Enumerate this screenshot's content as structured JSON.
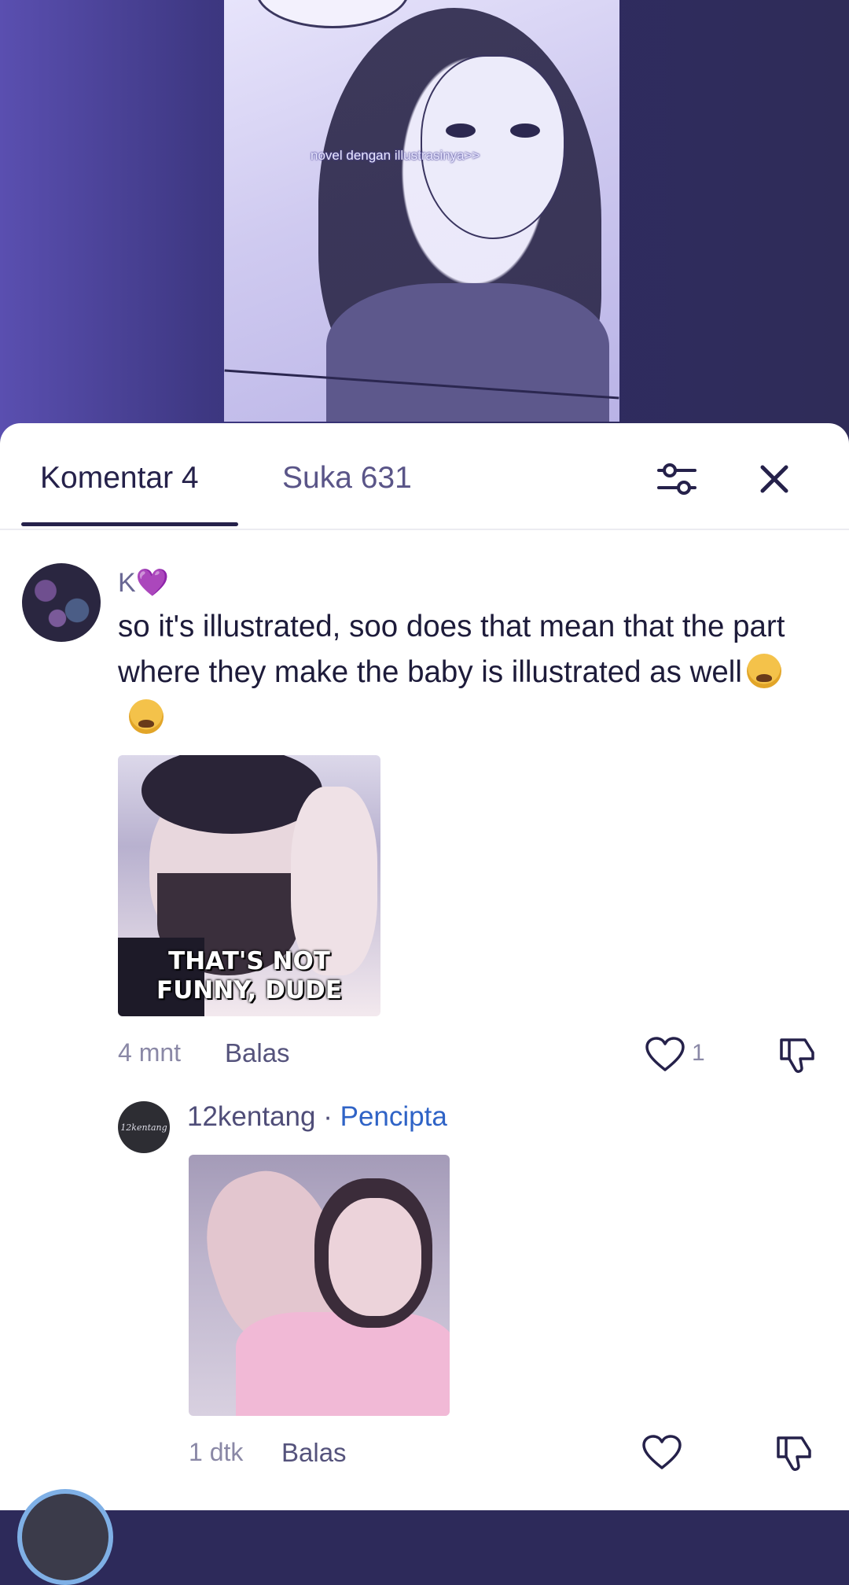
{
  "video": {
    "caption": "novel dengan illustrasinya>>"
  },
  "tabs": [
    {
      "label": "Komentar 4",
      "active": true
    },
    {
      "label": "Suka 631",
      "active": false
    }
  ],
  "toolbar": {
    "filter_icon": "sliders-icon",
    "close_icon": "close-icon"
  },
  "comments": [
    {
      "username": "K💜",
      "text": "so it's illustrated, soo does that mean that the part where they make the baby is illustrated as well",
      "emojis": [
        "loudly-crying-face",
        "loudly-crying-face"
      ],
      "gif_caption_line1": "THAT'S NOT",
      "gif_caption_line2": "FUNNY, DUDE",
      "time": "4 mnt",
      "reply_label": "Balas",
      "likes": "1"
    }
  ],
  "reply": {
    "username": "12kentang",
    "separator": "·",
    "badge": "Pencipta",
    "avatar_text": "12kentang",
    "time": "1 dtk",
    "reply_label": "Balas"
  },
  "colors": {
    "accent_dark": "#25214a",
    "creator_badge": "#2f63c6",
    "sheet_bg": "#ffffff"
  }
}
